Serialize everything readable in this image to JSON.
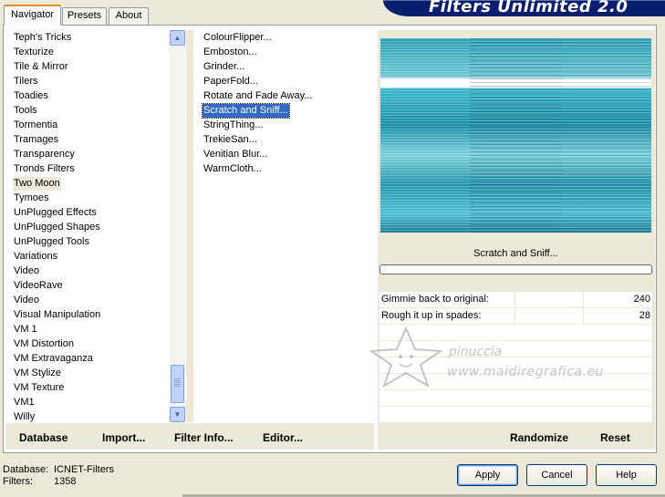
{
  "title": "Filters Unlimited 2.0",
  "tabs": [
    {
      "label": "Navigator",
      "active": true
    },
    {
      "label": "Presets",
      "active": false
    },
    {
      "label": "About",
      "active": false
    }
  ],
  "categories": [
    "Teph's Tricks",
    "Texturize",
    "Tile & Mirror",
    "Tilers",
    "Toadies",
    "Tools",
    "Tormentia",
    "Tramages",
    "Transparency",
    "Tronds Filters",
    "Two Moon",
    "Tymoes",
    "UnPlugged Effects",
    "UnPlugged Shapes",
    "UnPlugged Tools",
    "Variations",
    "Video",
    "VideoRave",
    "Video",
    "Visual Manipulation",
    "VM 1",
    "VM Distortion",
    "VM Extravaganza",
    "VM Stylize",
    "VM Texture",
    "VM1",
    "Willy"
  ],
  "selected_category": "Two Moon",
  "filters": [
    "ColourFlipper...",
    "Emboston...",
    "Grinder...",
    "PaperFold...",
    "Rotate and Fade Away...",
    "Scratch and Sniff...",
    "StringThing...",
    "TrekieSan...",
    "Venitian Blur...",
    "WarmCloth..."
  ],
  "selected_filter": "Scratch and Sniff...",
  "toolbar": {
    "database": "Database",
    "import": "Import...",
    "filter_info": "Filter Info...",
    "editor": "Editor...",
    "randomize": "Randomize",
    "reset": "Reset"
  },
  "preview_filter_name": "Scratch and Sniff...",
  "parameters": [
    {
      "label": "Gimmie back to original:",
      "value": "240"
    },
    {
      "label": "Rough it up in spades:",
      "value": "28"
    }
  ],
  "watermark": {
    "line1": "pinuccia",
    "line2": "www.maidiregrafica.eu"
  },
  "status": {
    "database_label": "Database:",
    "database_value": "ICNET-Filters",
    "filters_label": "Filters:",
    "filters_value": "1358"
  },
  "buttons": {
    "apply": "Apply",
    "cancel": "Cancel",
    "help": "Help"
  },
  "scroll_arrows": {
    "up": "▲",
    "down": "▼"
  },
  "colors": {
    "selection": "#316ac5",
    "banner": "#0a1e6e",
    "tab_accent": "#e68b2c"
  }
}
